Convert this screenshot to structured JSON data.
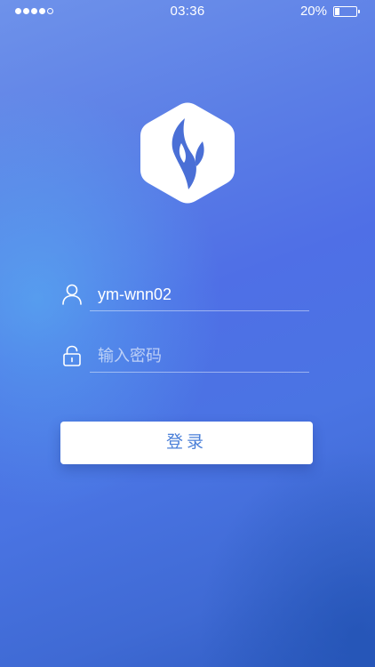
{
  "status_bar": {
    "time": "03:36",
    "battery_percent": "20%",
    "signal_bars_filled": 4,
    "signal_bars_total": 5,
    "battery_level": 0.2
  },
  "logo": {
    "icon": "flame-logo-icon",
    "background_color": "#ffffff",
    "flame_color": "#4a6fd6"
  },
  "login_form": {
    "username": {
      "icon": "user-icon",
      "value": "ym-wnn02"
    },
    "password": {
      "icon": "lock-icon",
      "placeholder": "输入密码"
    },
    "submit_label": "登录"
  },
  "colors": {
    "background_top": "#6e92ea",
    "background_bottom": "#2f5cc2",
    "button_text": "#4a7fd8"
  }
}
